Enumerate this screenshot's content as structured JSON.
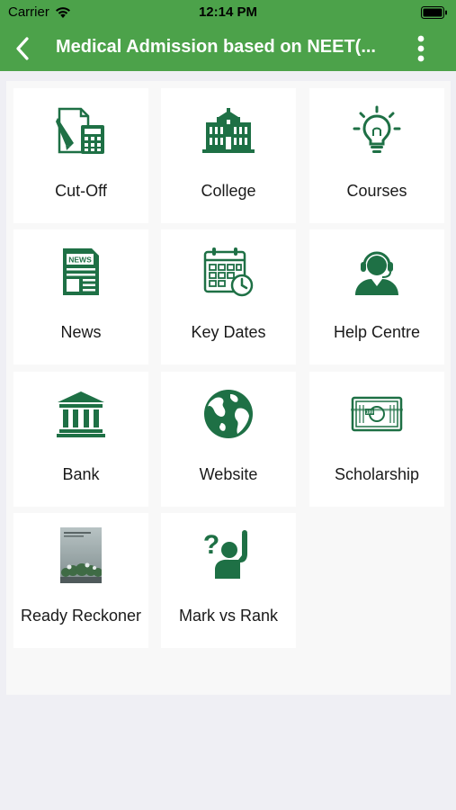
{
  "status_bar": {
    "carrier": "Carrier",
    "time": "12:14 PM"
  },
  "nav": {
    "title": "Medical Admission based on NEET(..."
  },
  "tiles": [
    {
      "label": "Cut-Off",
      "icon": "cut-off-icon"
    },
    {
      "label": "College",
      "icon": "college-building-icon"
    },
    {
      "label": "Courses",
      "icon": "lightbulb-icon"
    },
    {
      "label": "News",
      "icon": "newspaper-icon"
    },
    {
      "label": "Key Dates",
      "icon": "calendar-clock-icon"
    },
    {
      "label": "Help Centre",
      "icon": "support-agent-icon"
    },
    {
      "label": "Bank",
      "icon": "bank-icon"
    },
    {
      "label": "Website",
      "icon": "globe-icon"
    },
    {
      "label": "Scholarship",
      "icon": "money-bill-icon"
    },
    {
      "label": "Ready Reckoner",
      "icon": "book-cover-image"
    },
    {
      "label": "Mark vs Rank",
      "icon": "question-raise-hand-icon"
    }
  ],
  "colors": {
    "header": "#4ca24a",
    "icon": "#1e7045",
    "background": "#efeff4",
    "tile": "#ffffff"
  }
}
